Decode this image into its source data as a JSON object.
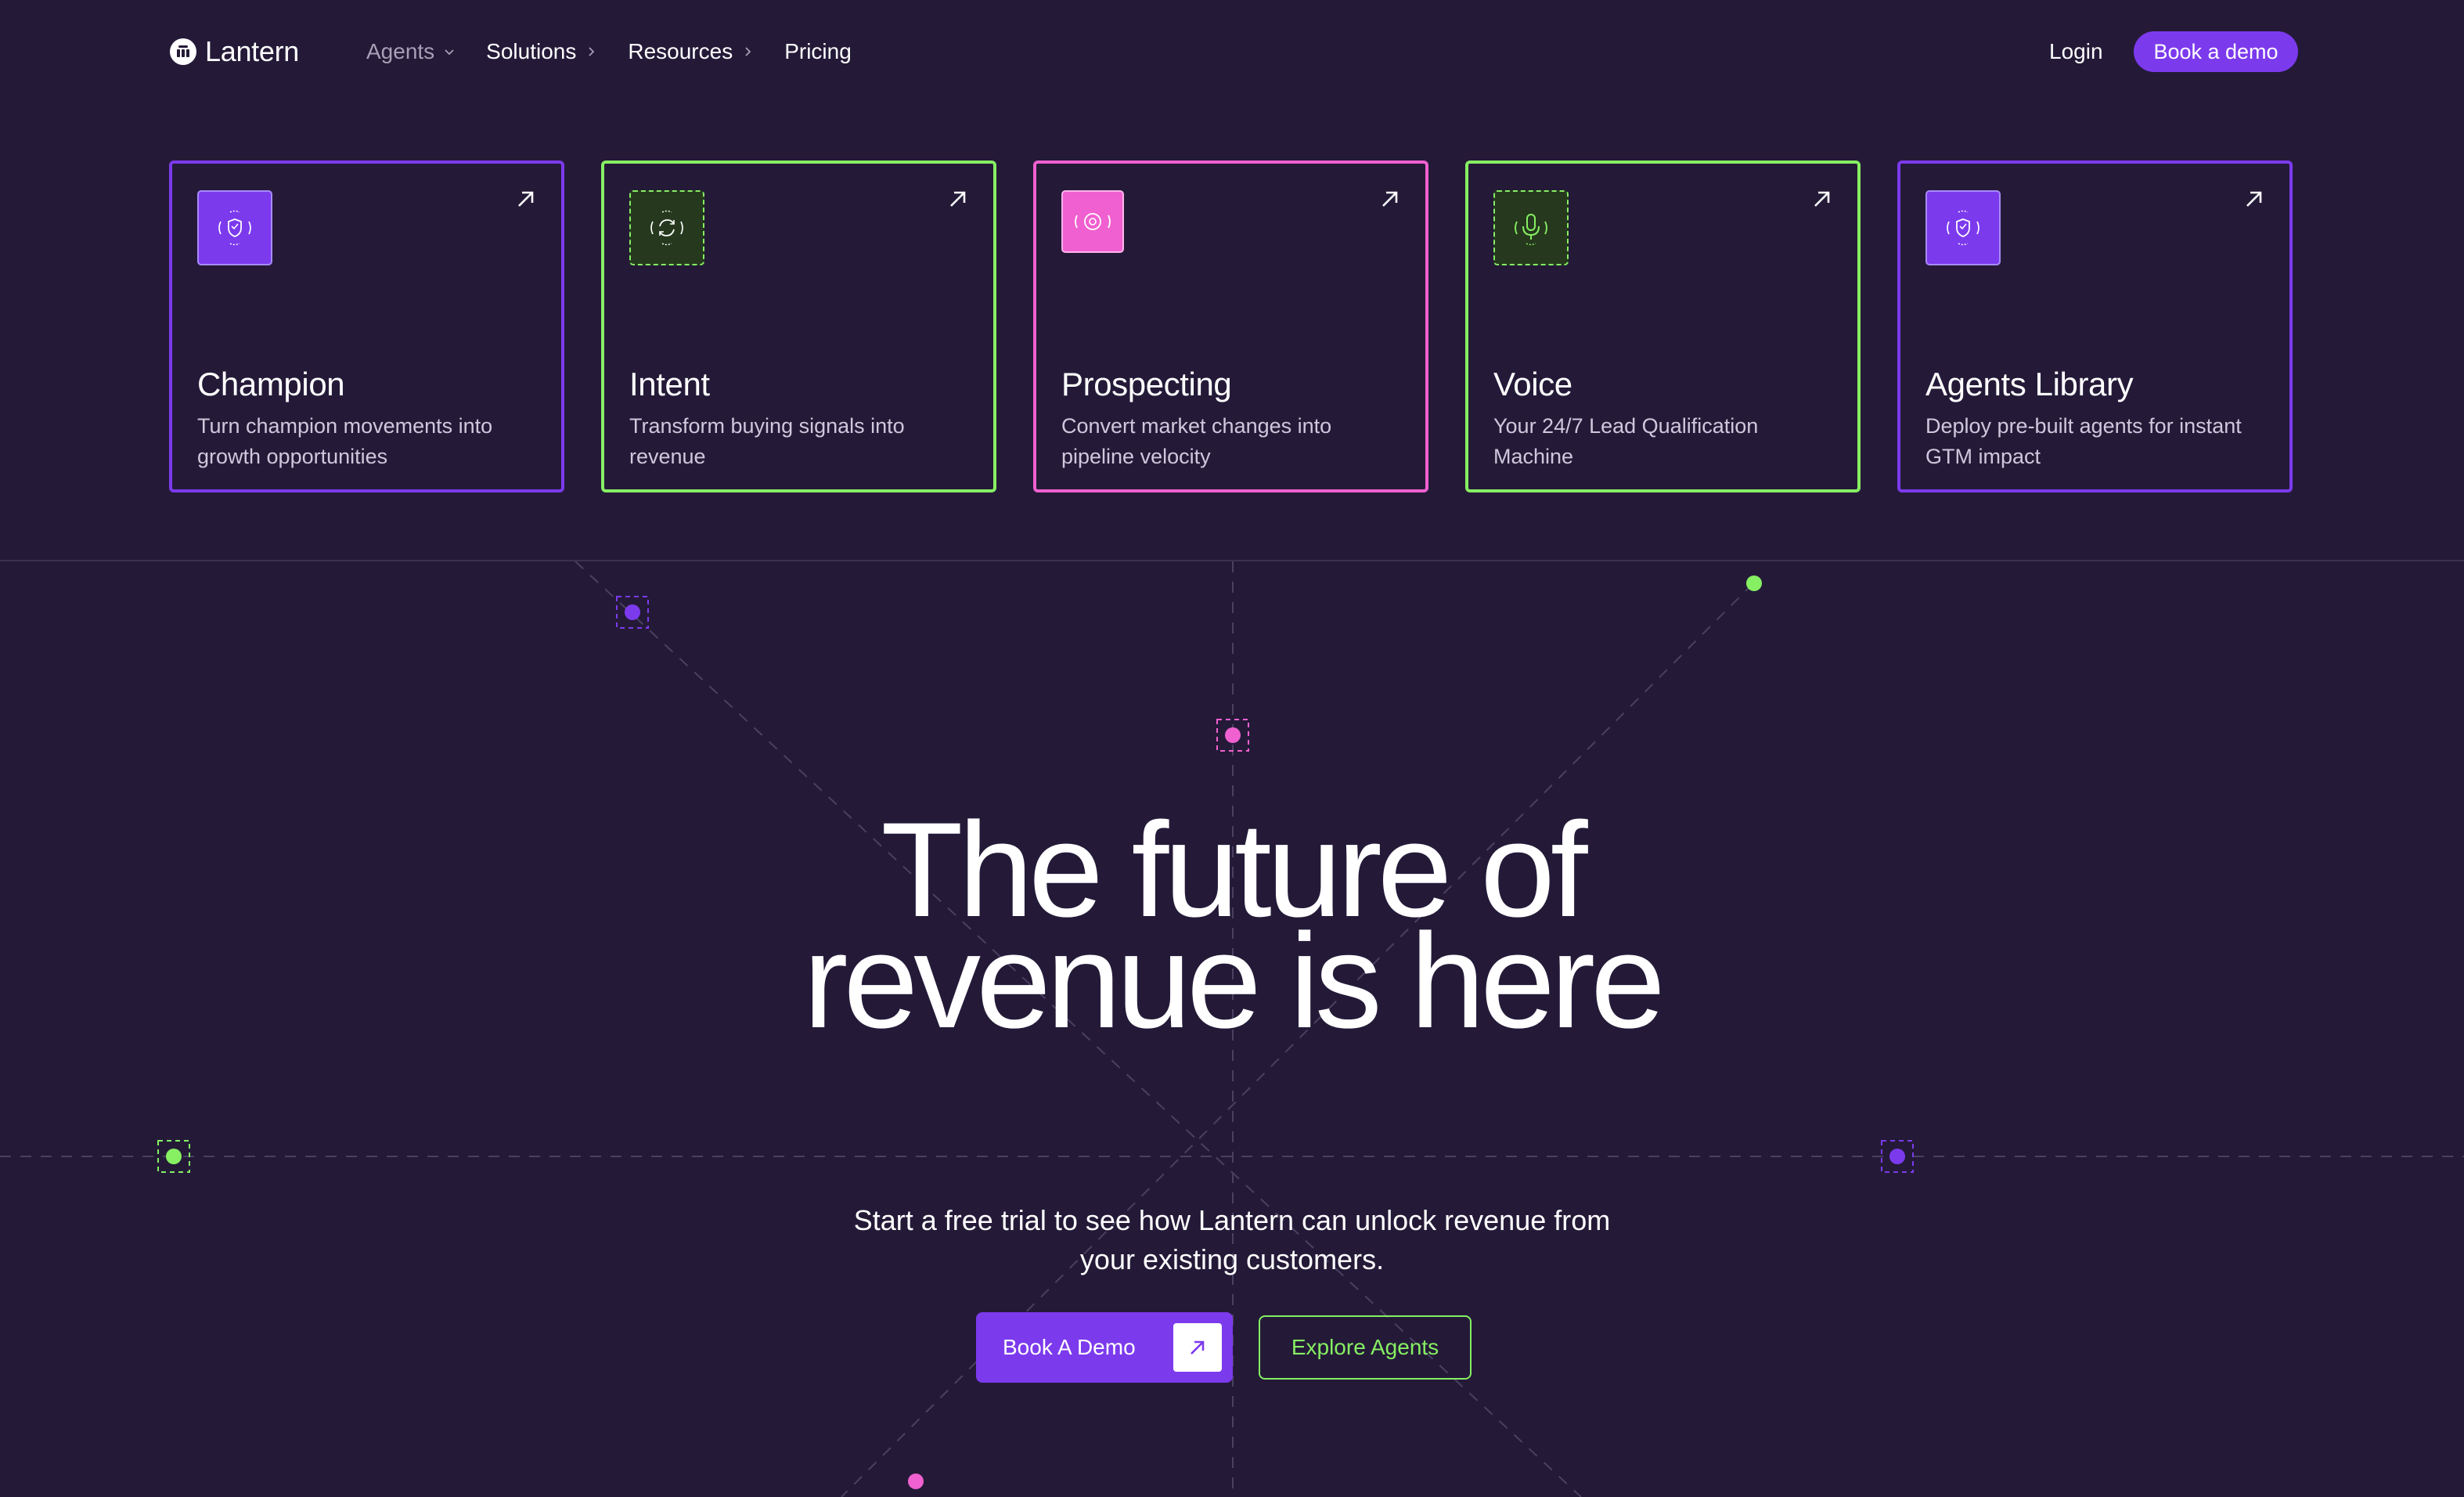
{
  "nav": {
    "brand": "Lantern",
    "links": [
      {
        "label": "Agents",
        "icon": "chevron-down-icon"
      },
      {
        "label": "Solutions",
        "icon": "chevron-right-icon"
      },
      {
        "label": "Resources",
        "icon": "chevron-right-icon"
      },
      {
        "label": "Pricing"
      }
    ],
    "login": "Login",
    "cta": "Book a demo"
  },
  "agents": [
    {
      "title": "Champion",
      "description": "Turn champion movements into growth opportunities",
      "accent": "#7c3aed",
      "icon": "shield-icon"
    },
    {
      "title": "Intent",
      "description": "Transform buying signals into revenue",
      "accent": "#86ef62",
      "icon": "refresh-icon"
    },
    {
      "title": "Prospecting",
      "description": "Convert market changes into pipeline velocity",
      "accent": "#f060d0",
      "icon": "target-icon"
    },
    {
      "title": "Voice",
      "description": "Your 24/7 Lead Qualification Machine",
      "accent": "#86ef62",
      "icon": "microphone-icon"
    },
    {
      "title": "Agents Library",
      "description": "Deploy pre-built agents for instant GTM impact",
      "accent": "#7c3aed",
      "icon": "shield-icon"
    }
  ],
  "hero": {
    "title": "The future of revenue is here",
    "subtitle": "Start a free trial to see how Lantern can unlock revenue from your existing customers.",
    "primary_cta": "Book A Demo",
    "secondary_cta": "Explore Agents"
  },
  "colors": {
    "background": "#241a38",
    "purple": "#7c3aed",
    "green": "#86ef62",
    "pink": "#f060d0"
  }
}
